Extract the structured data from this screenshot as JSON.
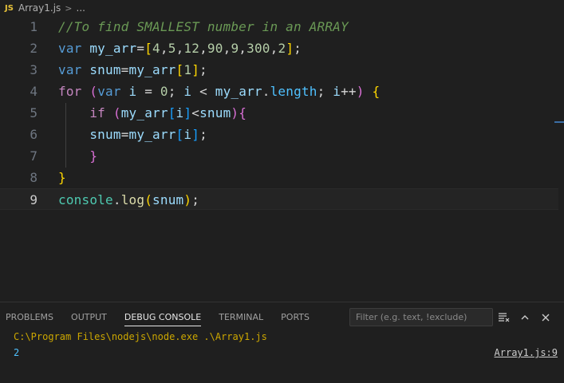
{
  "breadcrumb": {
    "file_icon": "JS",
    "file": "Array1.js",
    "separator": ">",
    "ellipsis": "..."
  },
  "editor": {
    "active_line": 9,
    "lines": [
      {
        "n": "1"
      },
      {
        "n": "2"
      },
      {
        "n": "3"
      },
      {
        "n": "4"
      },
      {
        "n": "5"
      },
      {
        "n": "6"
      },
      {
        "n": "7"
      },
      {
        "n": "8"
      },
      {
        "n": "9"
      }
    ],
    "tokens": {
      "l1": [
        "//To find SMALLEST number in an ARRAY"
      ],
      "l2": [
        "var",
        " my_arr",
        "=",
        "[",
        "4",
        ",",
        "5",
        ",",
        "12",
        ",",
        "90",
        ",",
        "9",
        ",",
        "300",
        ",",
        "2",
        "]",
        ";"
      ],
      "l3": [
        "var",
        " snum",
        "=",
        "my_arr",
        "[",
        "1",
        "]",
        ";"
      ],
      "l4": [
        "for",
        " ",
        "(",
        "var",
        " i ",
        "=",
        " ",
        "0",
        "; ",
        "i",
        " < ",
        "my_arr",
        ".",
        "length",
        "; ",
        "i",
        "++",
        ")",
        " ",
        "{"
      ],
      "l5": [
        "    ",
        "if",
        " ",
        "(",
        "my_arr",
        "[",
        "i",
        "]",
        "<",
        "snum",
        ")",
        "{"
      ],
      "l6": [
        "    ",
        "snum",
        "=",
        "my_arr",
        "[",
        "i",
        "]",
        ";"
      ],
      "l7": [
        "    ",
        "}"
      ],
      "l8": [
        "}"
      ],
      "l9": [
        "console",
        ".",
        "log",
        "(",
        "snum",
        ")",
        ";"
      ]
    }
  },
  "panel": {
    "tabs": [
      "PROBLEMS",
      "OUTPUT",
      "DEBUG CONSOLE",
      "TERMINAL",
      "PORTS"
    ],
    "active_tab": "DEBUG CONSOLE",
    "filter_placeholder": "Filter (e.g. text, !exclude)",
    "icons": [
      "clear-console-icon",
      "chevron-up-icon",
      "close-icon"
    ],
    "output": {
      "command": "C:\\Program Files\\nodejs\\node.exe .\\Array1.js",
      "value": "2",
      "source_link": "Array1.js:9"
    }
  }
}
